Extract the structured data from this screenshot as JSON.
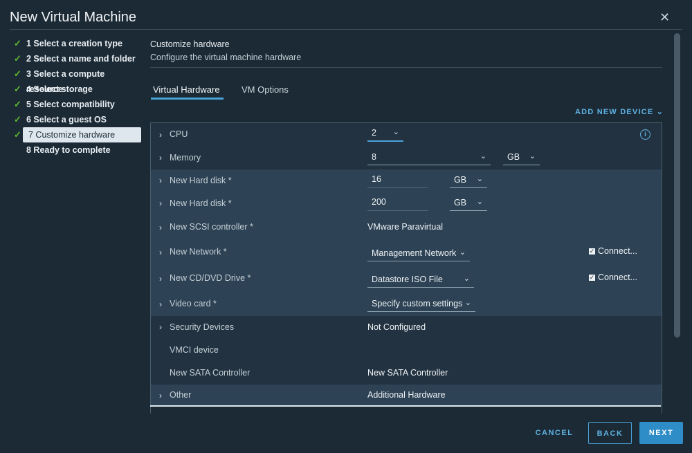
{
  "window": {
    "title": "New Virtual Machine"
  },
  "steps": [
    {
      "label": "1 Select a creation type",
      "done": true
    },
    {
      "label": "2 Select a name and folder",
      "done": true
    },
    {
      "label": "3 Select a compute resource",
      "done": true
    },
    {
      "label": "4 Select storage",
      "done": true
    },
    {
      "label": "5 Select compatibility",
      "done": true
    },
    {
      "label": "6 Select a guest OS",
      "done": true
    },
    {
      "label": "7 Customize hardware",
      "done": true,
      "active": true
    },
    {
      "label": "8 Ready to complete",
      "done": false
    }
  ],
  "header": {
    "title": "Customize hardware",
    "subtitle": "Configure the virtual machine hardware"
  },
  "tabs": [
    {
      "label": "Virtual Hardware",
      "active": true
    },
    {
      "label": "VM Options",
      "active": false
    }
  ],
  "add_device_label": "ADD NEW DEVICE",
  "hardware": {
    "cpu": {
      "label": "CPU",
      "value": "2"
    },
    "memory": {
      "label": "Memory",
      "value": "8",
      "unit": "GB"
    },
    "disk1": {
      "label": "New Hard disk *",
      "value": "16",
      "unit": "GB"
    },
    "disk2": {
      "label": "New Hard disk *",
      "value": "200",
      "unit": "GB"
    },
    "scsi": {
      "label": "New SCSI controller *",
      "value": "VMware Paravirtual"
    },
    "network": {
      "label": "New Network *",
      "value": "Management Network",
      "connect": "Connect..."
    },
    "cdrom": {
      "label": "New CD/DVD Drive *",
      "value": "Datastore ISO File",
      "connect": "Connect..."
    },
    "video": {
      "label": "Video card *",
      "value": "Specify custom settings"
    },
    "security": {
      "label": "Security Devices",
      "value": "Not Configured"
    },
    "vmci": {
      "label": "VMCI device"
    },
    "sata": {
      "label": "New SATA Controller",
      "value": "New SATA Controller"
    },
    "other": {
      "label": "Other",
      "value": "Additional Hardware"
    }
  },
  "footer": {
    "cancel": "CANCEL",
    "back": "BACK",
    "next": "NEXT"
  },
  "icons": {
    "check": "check-icon",
    "close": "close-icon",
    "chevron": "chevron-right-icon",
    "dropdown": "chevron-down-icon",
    "info": "info-icon"
  },
  "colors": {
    "accent": "#4aa3d9",
    "success": "#5fb832",
    "background": "#1b2a35"
  }
}
